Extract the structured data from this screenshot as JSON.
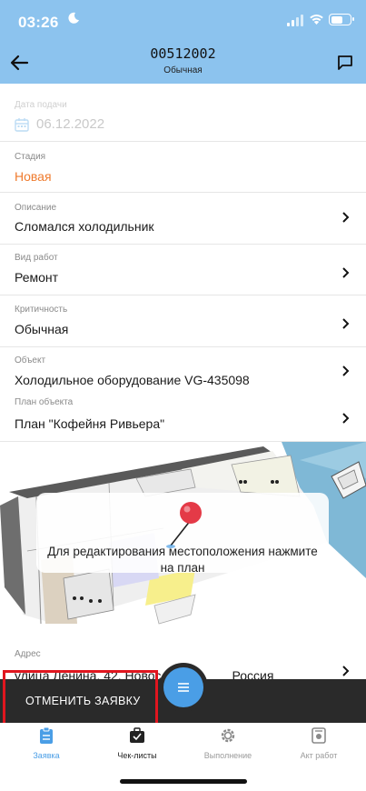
{
  "status": {
    "time": "03:26"
  },
  "header": {
    "title": "00512002",
    "subtitle": "Обычная"
  },
  "fields": {
    "date": {
      "label": "Дата подачи",
      "value": "06.12.2022"
    },
    "stage": {
      "label": "Стадия",
      "value": "Новая"
    },
    "description": {
      "label": "Описание",
      "value": "Сломался холодильник"
    },
    "work_type": {
      "label": "Вид работ",
      "value": "Ремонт"
    },
    "criticality": {
      "label": "Критичность",
      "value": "Обычная"
    },
    "object": {
      "label": "Объект",
      "value": "Холодильное оборудование VG-435098"
    },
    "object_plan": {
      "label": "План объекта",
      "value": "План \"Кофейня Ривьера\""
    },
    "address": {
      "label": "Адрес",
      "value": "улица Ленина, 42, Новос",
      "value_tail": "Россия"
    }
  },
  "plan": {
    "overlay_text": "Для редактирования местоположения нажмите на план"
  },
  "actions": {
    "cancel_label": "ОТМЕНИТЬ ЗАЯВКУ",
    "fab_icon": "menu-icon"
  },
  "tabs": [
    {
      "label": "Заявка",
      "icon": "clipboard-icon"
    },
    {
      "label": "Чек-листы",
      "icon": "briefcase-check-icon"
    },
    {
      "label": "Выполнение",
      "icon": "gear-icon"
    },
    {
      "label": "Акт работ",
      "icon": "act-icon"
    }
  ],
  "colors": {
    "header": "#8cc3ee",
    "accent": "#4a9ee6",
    "stage": "#ef7b2e",
    "highlight": "#e0161f"
  }
}
